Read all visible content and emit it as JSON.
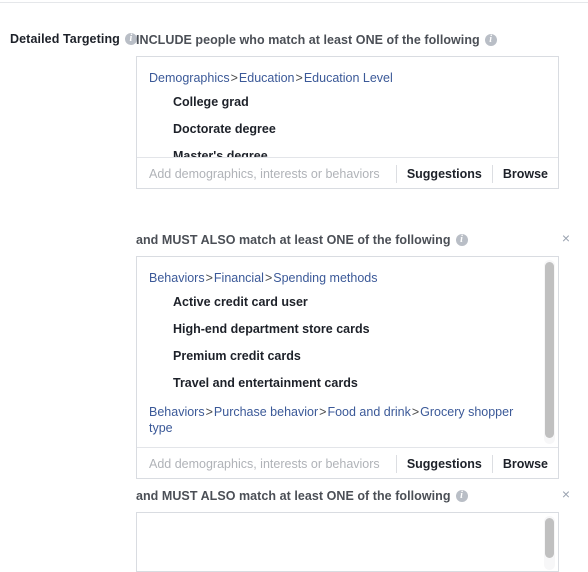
{
  "field": {
    "label": "Detailed Targeting",
    "info_icon": "info-icon"
  },
  "groups": [
    {
      "header": "INCLUDE people who match at least ONE of the following",
      "info_icon": "info-icon",
      "closable": false,
      "close_icon": "",
      "has_scrollbar": false,
      "entries": [
        {
          "breadcrumb": [
            "Demographics",
            "Education",
            "Education Level"
          ],
          "selections": [
            "College grad",
            "Doctorate degree",
            "Master's degree"
          ]
        }
      ],
      "input": {
        "value": "",
        "placeholder": "Add demographics, interests or behaviors"
      },
      "actions": [
        "Suggestions",
        "Browse"
      ]
    },
    {
      "header": "and MUST ALSO match at least ONE of the following",
      "info_icon": "info-icon",
      "closable": true,
      "close_icon": "×",
      "has_scrollbar": true,
      "entries": [
        {
          "breadcrumb": [
            "Behaviors",
            "Financial",
            "Spending methods"
          ],
          "selections": [
            "Active credit card user",
            "High-end department store cards",
            "Premium credit cards",
            "Travel and entertainment cards"
          ]
        },
        {
          "breadcrumb": [
            "Behaviors",
            "Purchase behavior",
            "Food and drink",
            "Grocery shopper type"
          ],
          "selections": []
        }
      ],
      "input": {
        "value": "",
        "placeholder": "Add demographics, interests or behaviors"
      },
      "actions": [
        "Suggestions",
        "Browse"
      ]
    },
    {
      "header": "and MUST ALSO match at least ONE of the following",
      "info_icon": "info-icon",
      "closable": true,
      "close_icon": "×",
      "has_scrollbar": true,
      "entries": [],
      "input": {
        "value": "",
        "placeholder": ""
      },
      "actions": []
    }
  ],
  "separator": ">",
  "colors": {
    "link": "#3b5998",
    "text": "#1d2129",
    "muted": "#4b4f56",
    "placeholder": "#b0b3b8",
    "border": "#d9dce1",
    "info_icon": "#b9bec6",
    "close_icon": "#9aa3b0",
    "scroll_thumb": "#c0c0c0"
  }
}
